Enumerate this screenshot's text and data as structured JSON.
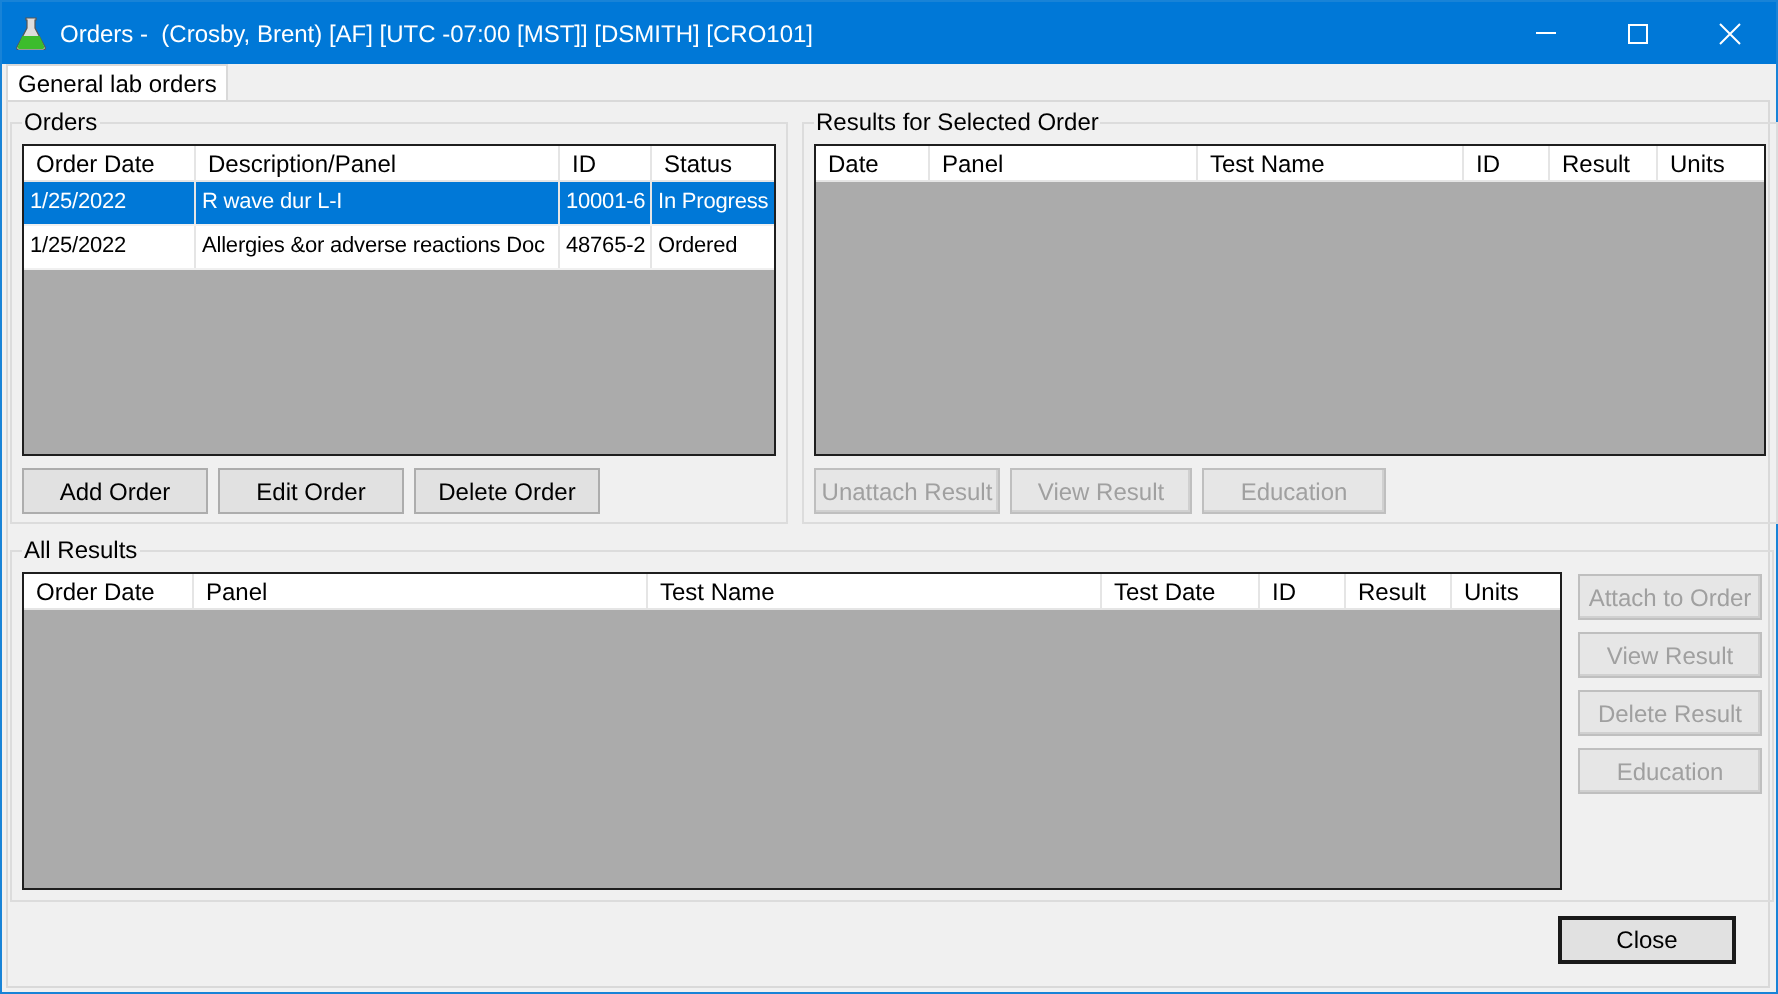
{
  "window": {
    "title": "Orders -  (Crosby, Brent) [AF] [UTC -07:00 [MST]] [DSMITH] [CRO101]"
  },
  "tabs": [
    {
      "label": "General lab orders",
      "selected": true
    }
  ],
  "orders": {
    "title": "Orders",
    "columns": [
      "Order Date",
      "Description/Panel",
      "ID",
      "Status"
    ],
    "rows": [
      {
        "cells": [
          "1/25/2022",
          "R wave dur L-I",
          "10001-6",
          "In Progress"
        ],
        "selected": true
      },
      {
        "cells": [
          "1/25/2022",
          "Allergies &or adverse reactions Doc",
          "48765-2",
          "Ordered"
        ],
        "selected": false
      }
    ],
    "buttons": [
      {
        "label": "Add Order",
        "disabled": false
      },
      {
        "label": "Edit Order",
        "disabled": false
      },
      {
        "label": "Delete Order",
        "disabled": false
      }
    ]
  },
  "results_for_selected_order": {
    "title": "Results for Selected Order",
    "columns": [
      "Date",
      "Panel",
      "Test Name",
      "ID",
      "Result",
      "Units"
    ],
    "buttons": [
      {
        "label": "Unattach Result",
        "disabled": true
      },
      {
        "label": "View Result",
        "disabled": true
      },
      {
        "label": "Education",
        "disabled": true
      }
    ]
  },
  "all_results": {
    "title": "All Results",
    "columns": [
      "Order Date",
      "Panel",
      "Test Name",
      "Test Date",
      "ID",
      "Result",
      "Units"
    ],
    "buttons": [
      {
        "label": "Attach to Order",
        "disabled": true
      },
      {
        "label": "View Result",
        "disabled": true
      },
      {
        "label": "Delete Result",
        "disabled": true
      },
      {
        "label": "Education",
        "disabled": true
      }
    ]
  },
  "close_button": {
    "label": "Close",
    "disabled": false
  }
}
